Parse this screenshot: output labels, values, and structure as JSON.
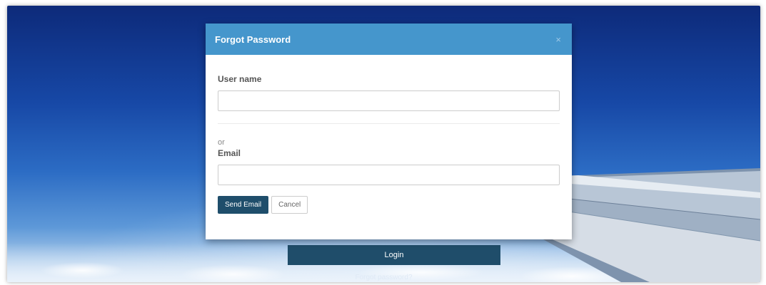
{
  "modal": {
    "title": "Forgot Password",
    "close_icon": "×",
    "username_label": "User name",
    "username_value": "",
    "or_text": "or",
    "email_label": "Email",
    "email_value": "",
    "send_button": "Send Email",
    "cancel_button": "Cancel"
  },
  "login": {
    "button_label": "Login",
    "forgot_link": "Forgot password?"
  },
  "colors": {
    "header": "#4596cc",
    "primary_button": "#1f4e6b"
  }
}
